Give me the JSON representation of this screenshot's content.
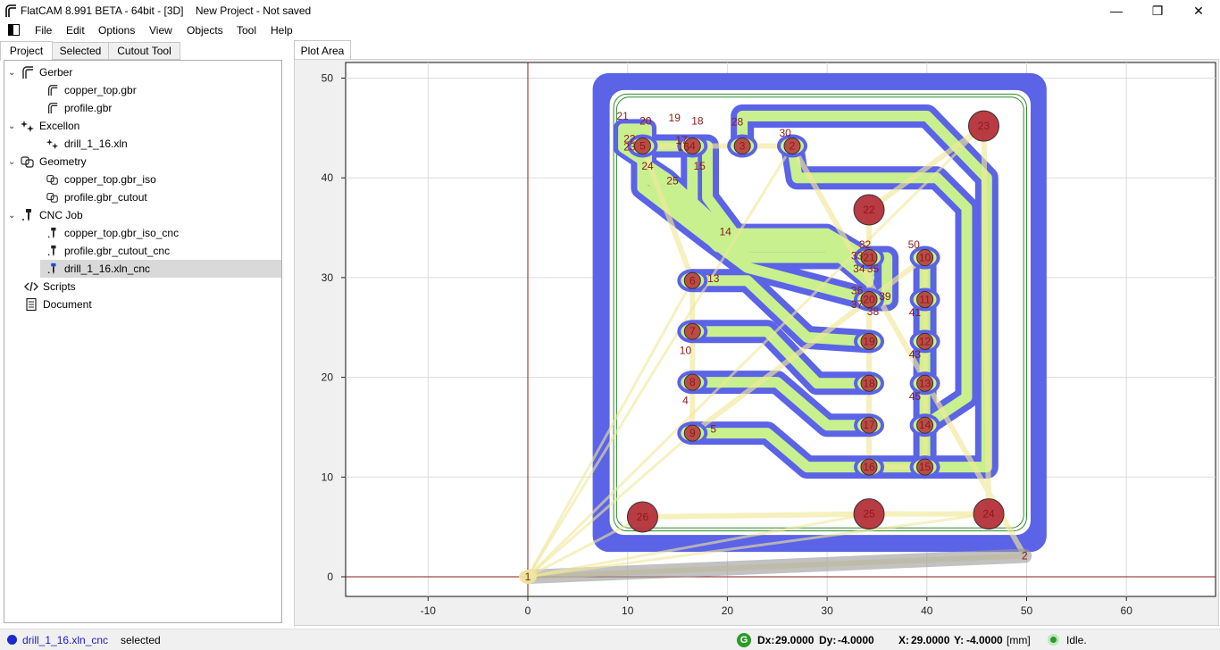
{
  "window": {
    "title": "FlatCAM 8.991 BETA - 64bit - [3D]    New Project - Not saved",
    "minimize": "—",
    "maximize": "❐",
    "close": "✕"
  },
  "menu": {
    "items": [
      "File",
      "Edit",
      "Options",
      "View",
      "Objects",
      "Tool",
      "Help"
    ]
  },
  "left_tabs": [
    "Project",
    "Selected",
    "Cutout Tool"
  ],
  "tree": {
    "groups": [
      {
        "label": "Gerber",
        "icon": "gerber-icon",
        "children": [
          "copper_top.gbr",
          "profile.gbr"
        ]
      },
      {
        "label": "Excellon",
        "icon": "excellon-icon",
        "children": [
          "drill_1_16.xln"
        ]
      },
      {
        "label": "Geometry",
        "icon": "geometry-icon",
        "children": [
          "copper_top.gbr_iso",
          "profile.gbr_cutout"
        ]
      },
      {
        "label": "CNC Job",
        "icon": "cncjob-icon",
        "children": [
          "copper_top.gbr_iso_cnc",
          "profile.gbr_cutout_cnc",
          "drill_1_16.xln_cnc"
        ]
      }
    ],
    "extra": [
      {
        "label": "Scripts",
        "icon": "scripts-icon"
      },
      {
        "label": "Document",
        "icon": "document-icon"
      }
    ],
    "selected": "drill_1_16.xln_cnc"
  },
  "plot": {
    "tab_label": "Plot Area",
    "x_ticks": [
      "-10",
      "0",
      "10",
      "20",
      "30",
      "40",
      "50",
      "60"
    ],
    "y_ticks": [
      "0",
      "10",
      "20",
      "30",
      "40",
      "50"
    ],
    "drill_labels": [
      {
        "n": "1",
        "x": 0,
        "y": 0
      },
      {
        "n": "2",
        "x": 49.8,
        "y": 2.1
      },
      {
        "n": "2",
        "x": 26.5,
        "y": 43.2
      },
      {
        "n": "3",
        "x": 21.5,
        "y": 43.2
      },
      {
        "n": "4",
        "x": 16.5,
        "y": 43.2
      },
      {
        "n": "5",
        "x": 11.5,
        "y": 43.2
      },
      {
        "n": "6",
        "x": 16.5,
        "y": 29.7
      },
      {
        "n": "7",
        "x": 16.5,
        "y": 24.6
      },
      {
        "n": "8",
        "x": 16.5,
        "y": 19.5
      },
      {
        "n": "9",
        "x": 16.5,
        "y": 14.4
      },
      {
        "n": "10",
        "x": 39.8,
        "y": 32.0
      },
      {
        "n": "11",
        "x": 39.8,
        "y": 27.8
      },
      {
        "n": "12",
        "x": 39.8,
        "y": 23.6
      },
      {
        "n": "13",
        "x": 39.8,
        "y": 19.4
      },
      {
        "n": "14",
        "x": 39.8,
        "y": 15.2
      },
      {
        "n": "15",
        "x": 39.8,
        "y": 11.0
      },
      {
        "n": "16",
        "x": 34.2,
        "y": 11.0
      },
      {
        "n": "17",
        "x": 34.2,
        "y": 15.2
      },
      {
        "n": "18",
        "x": 34.2,
        "y": 19.4
      },
      {
        "n": "19",
        "x": 34.2,
        "y": 23.6
      },
      {
        "n": "20",
        "x": 34.2,
        "y": 27.8
      },
      {
        "n": "21",
        "x": 34.2,
        "y": 32.0
      },
      {
        "n": "22",
        "x": 34.2,
        "y": 36.8
      },
      {
        "n": "23",
        "x": 45.7,
        "y": 45.2
      },
      {
        "n": "24",
        "x": 46.2,
        "y": 6.3
      },
      {
        "n": "25",
        "x": 34.2,
        "y": 6.3
      },
      {
        "n": "26",
        "x": 11.5,
        "y": 6.0
      },
      {
        "n": "21",
        "x": 9.5,
        "y": 46.2
      },
      {
        "n": "20",
        "x": 11.8,
        "y": 45.7
      },
      {
        "n": "19",
        "x": 14.7,
        "y": 46.0
      },
      {
        "n": "18",
        "x": 17.0,
        "y": 45.7
      },
      {
        "n": "22",
        "x": 10.2,
        "y": 43.9
      },
      {
        "n": "23",
        "x": 10.2,
        "y": 43.1
      },
      {
        "n": "17",
        "x": 15.4,
        "y": 43.8
      },
      {
        "n": "16",
        "x": 15.6,
        "y": 43.1
      },
      {
        "n": "24",
        "x": 12.0,
        "y": 41.2
      },
      {
        "n": "15",
        "x": 17.2,
        "y": 41.2
      },
      {
        "n": "25",
        "x": 14.5,
        "y": 39.7
      },
      {
        "n": "28",
        "x": 21.0,
        "y": 45.6
      },
      {
        "n": "30",
        "x": 25.8,
        "y": 44.5
      },
      {
        "n": "14",
        "x": 19.8,
        "y": 34.6
      },
      {
        "n": "13",
        "x": 18.6,
        "y": 29.9
      },
      {
        "n": "32",
        "x": 33.8,
        "y": 33.3
      },
      {
        "n": "33",
        "x": 33.0,
        "y": 32.2
      },
      {
        "n": "34",
        "x": 33.2,
        "y": 30.9
      },
      {
        "n": "35",
        "x": 34.6,
        "y": 30.9
      },
      {
        "n": "36",
        "x": 33.0,
        "y": 28.7
      },
      {
        "n": "37",
        "x": 33.0,
        "y": 27.3
      },
      {
        "n": "38",
        "x": 34.6,
        "y": 26.6
      },
      {
        "n": "39",
        "x": 35.8,
        "y": 28.1
      },
      {
        "n": "50",
        "x": 38.7,
        "y": 33.3
      },
      {
        "n": "41",
        "x": 38.8,
        "y": 26.5
      },
      {
        "n": "43",
        "x": 38.8,
        "y": 22.3
      },
      {
        "n": "45",
        "x": 38.8,
        "y": 18.1
      },
      {
        "n": "10",
        "x": 15.8,
        "y": 22.7
      },
      {
        "n": "4",
        "x": 15.8,
        "y": 17.7
      },
      {
        "n": "5",
        "x": 18.6,
        "y": 14.8
      }
    ]
  },
  "status": {
    "selected_name": "drill_1_16.xln_cnc",
    "selected_suffix": " selected",
    "dx_label": "Dx:",
    "dx_value": "29.0000",
    "dy_label": "Dy:",
    "dy_value": "-4.0000",
    "x_label": "X:",
    "x_value": "29.0000",
    "y_label": "Y:",
    "y_value": "-4.0000",
    "units": "[mm]",
    "state": "Idle."
  },
  "colors": {
    "copper_iso": "#5b63e6",
    "gerber_fill": "#c8f08e",
    "drill_fill": "#b5303a",
    "travel": "#f0e89a",
    "axis": "#8b1a1a"
  }
}
